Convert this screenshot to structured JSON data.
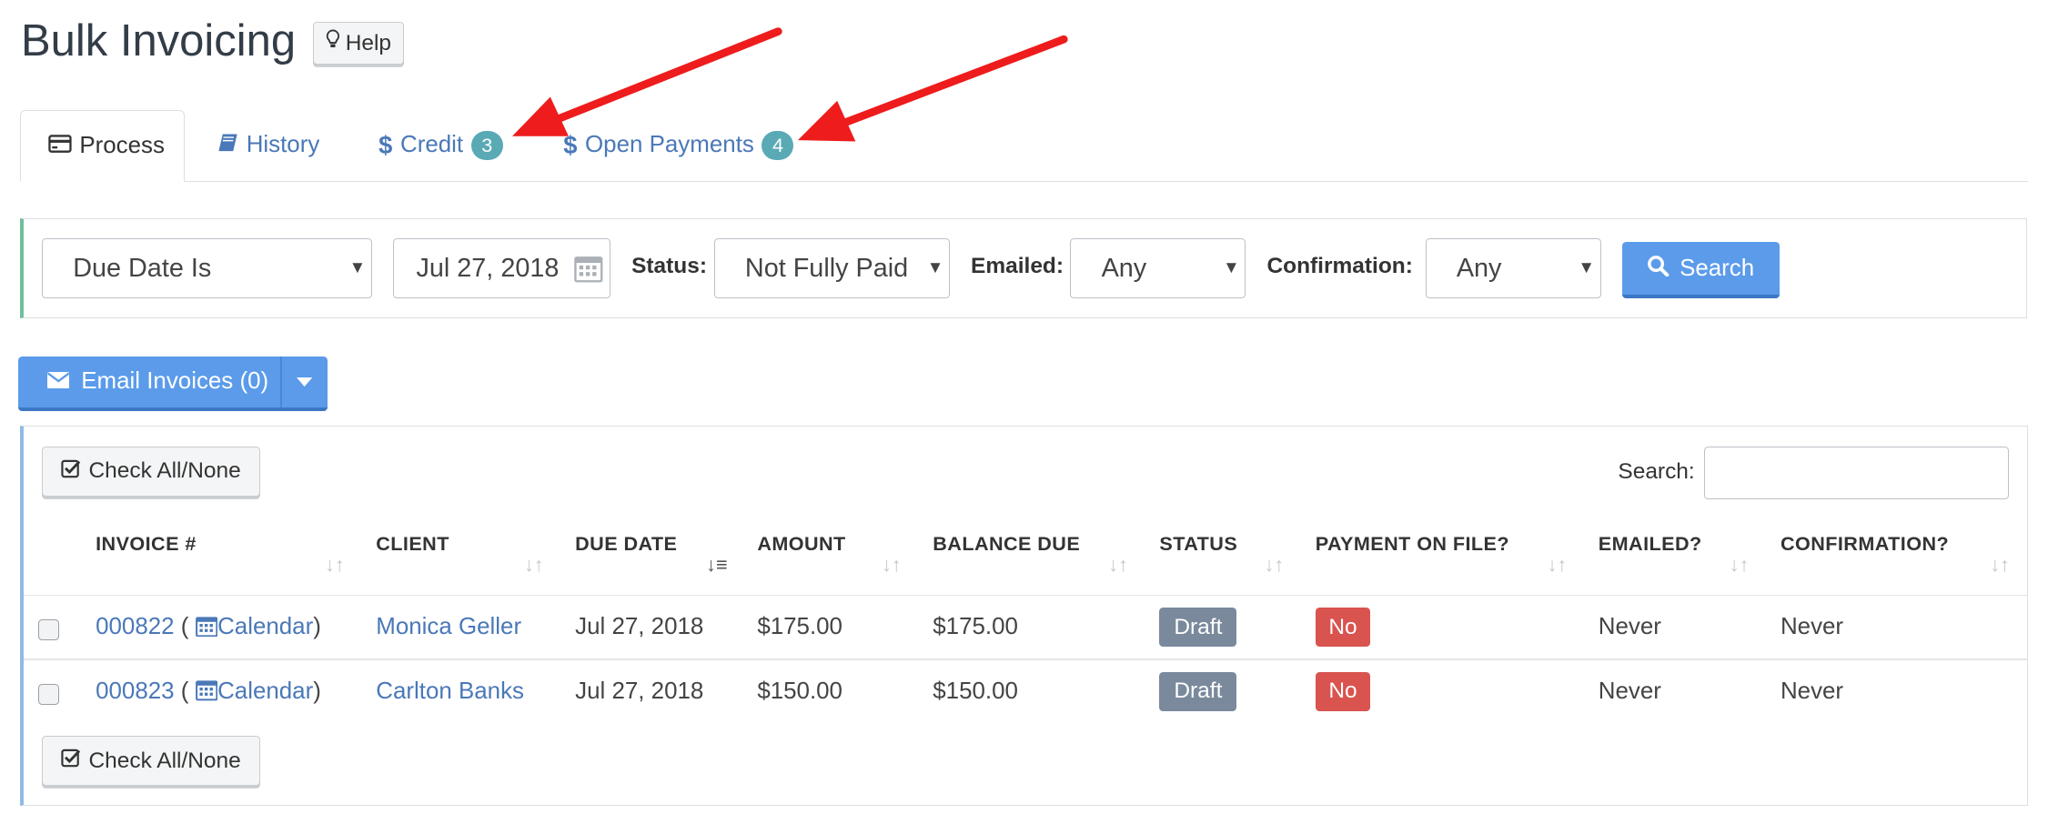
{
  "page": {
    "title": "Bulk Invoicing",
    "help_label": "Help"
  },
  "tabs": [
    {
      "label": "Process",
      "badge": null,
      "active": true,
      "icon": "credit-card-icon"
    },
    {
      "label": "History",
      "badge": null,
      "active": false,
      "icon": "book-icon"
    },
    {
      "label": "Credit",
      "badge": "3",
      "active": false,
      "icon": "dollar-icon"
    },
    {
      "label": "Open Payments",
      "badge": "4",
      "active": false,
      "icon": "dollar-icon"
    }
  ],
  "filters": {
    "date_mode": "Due Date Is",
    "date_value": "Jul 27, 2018",
    "status_label": "Status:",
    "status_value": "Not Fully Paid",
    "emailed_label": "Emailed:",
    "emailed_value": "Any",
    "confirmation_label": "Confirmation:",
    "confirmation_value": "Any",
    "search_button": "Search"
  },
  "email_button": {
    "label": "Email Invoices (0)"
  },
  "table": {
    "check_all_label": "Check All/None",
    "search_label": "Search:",
    "search_value": "",
    "columns": [
      "INVOICE #",
      "CLIENT",
      "DUE DATE",
      "AMOUNT",
      "BALANCE DUE",
      "STATUS",
      "PAYMENT ON FILE?",
      "EMAILED?",
      "CONFIRMATION?"
    ],
    "rows": [
      {
        "invoice": "000822",
        "calendar": "Calendar",
        "client": "Monica Geller",
        "due_date": "Jul 27, 2018",
        "amount": "$175.00",
        "balance": "$175.00",
        "status": "Draft",
        "payment_on_file": "No",
        "emailed": "Never",
        "confirmation": "Never"
      },
      {
        "invoice": "000823",
        "calendar": "Calendar",
        "client": "Carlton Banks",
        "due_date": "Jul 27, 2018",
        "amount": "$150.00",
        "balance": "$150.00",
        "status": "Draft",
        "payment_on_file": "No",
        "emailed": "Never",
        "confirmation": "Never"
      }
    ]
  },
  "colors": {
    "accent": "#5b9bea",
    "link": "#4a78b8",
    "badge": "#5aaab5",
    "draft": "#7a8a9c",
    "danger": "#d9534f",
    "arrow": "#ee1c1c"
  }
}
